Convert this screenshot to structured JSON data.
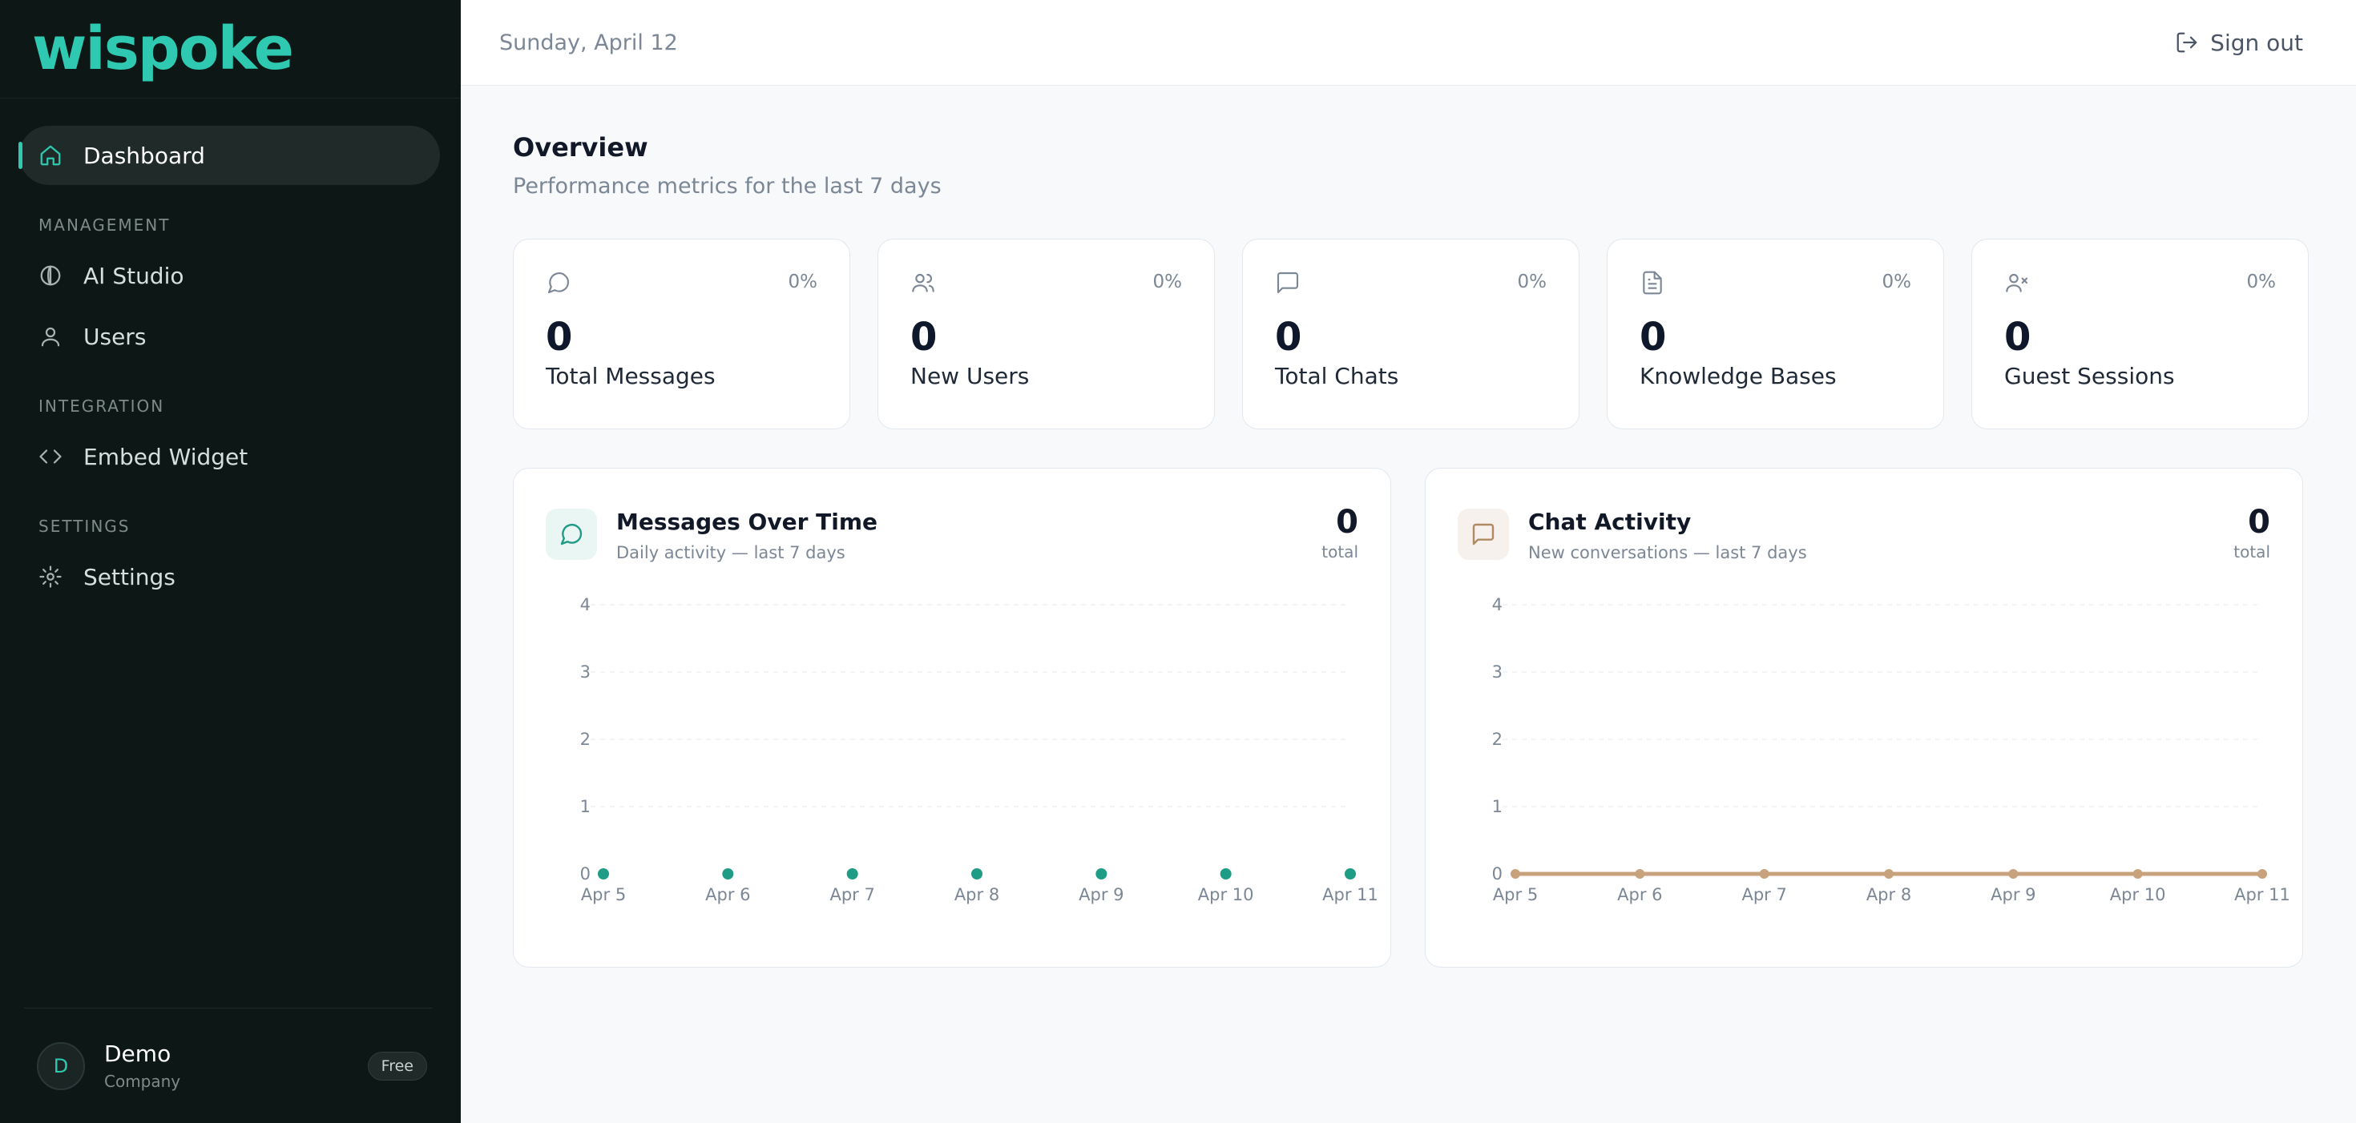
{
  "brand": {
    "name": "wispoke"
  },
  "sidebar": {
    "nav": {
      "dashboard": "Dashboard",
      "management_label": "MANAGEMENT",
      "ai_studio": "AI Studio",
      "users": "Users",
      "integration_label": "INTEGRATION",
      "embed_widget": "Embed Widget",
      "settings_label": "SETTINGS",
      "settings": "Settings"
    },
    "account": {
      "initial": "D",
      "name": "Demo",
      "sub": "Company",
      "plan": "Free"
    }
  },
  "topbar": {
    "date": "Sunday, April 12",
    "signout": "Sign out"
  },
  "overview": {
    "title": "Overview",
    "subtitle": "Performance metrics for the last 7 days"
  },
  "stats": [
    {
      "icon": "message-circle-icon",
      "pct": "0%",
      "value": "0",
      "label": "Total Messages"
    },
    {
      "icon": "users-icon",
      "pct": "0%",
      "value": "0",
      "label": "New Users"
    },
    {
      "icon": "message-square-icon",
      "pct": "0%",
      "value": "0",
      "label": "Total Chats"
    },
    {
      "icon": "file-text-icon",
      "pct": "0%",
      "value": "0",
      "label": "Knowledge Bases"
    },
    {
      "icon": "user-x-icon",
      "pct": "0%",
      "value": "0",
      "label": "Guest Sessions"
    }
  ],
  "colors": {
    "accent": "#2ec9b0",
    "messages": "#1e9c86",
    "chats": "#c7a27c"
  },
  "chart_data": [
    {
      "type": "scatter",
      "title": "Messages Over Time",
      "subtitle": "Daily activity — last 7 days",
      "total": "0",
      "total_label": "total",
      "x": [
        "Apr 5",
        "Apr 6",
        "Apr 7",
        "Apr 8",
        "Apr 9",
        "Apr 10",
        "Apr 11"
      ],
      "values": [
        0,
        0,
        0,
        0,
        0,
        0,
        0
      ],
      "ylim": [
        0,
        4
      ],
      "yticks": [
        0,
        1,
        2,
        3,
        4
      ],
      "grid": true
    },
    {
      "type": "line",
      "title": "Chat Activity",
      "subtitle": "New conversations — last 7 days",
      "total": "0",
      "total_label": "total",
      "x": [
        "Apr 5",
        "Apr 6",
        "Apr 7",
        "Apr 8",
        "Apr 9",
        "Apr 10",
        "Apr 11"
      ],
      "values": [
        0,
        0,
        0,
        0,
        0,
        0,
        0
      ],
      "ylim": [
        0,
        4
      ],
      "yticks": [
        0,
        1,
        2,
        3,
        4
      ],
      "grid": true
    }
  ]
}
